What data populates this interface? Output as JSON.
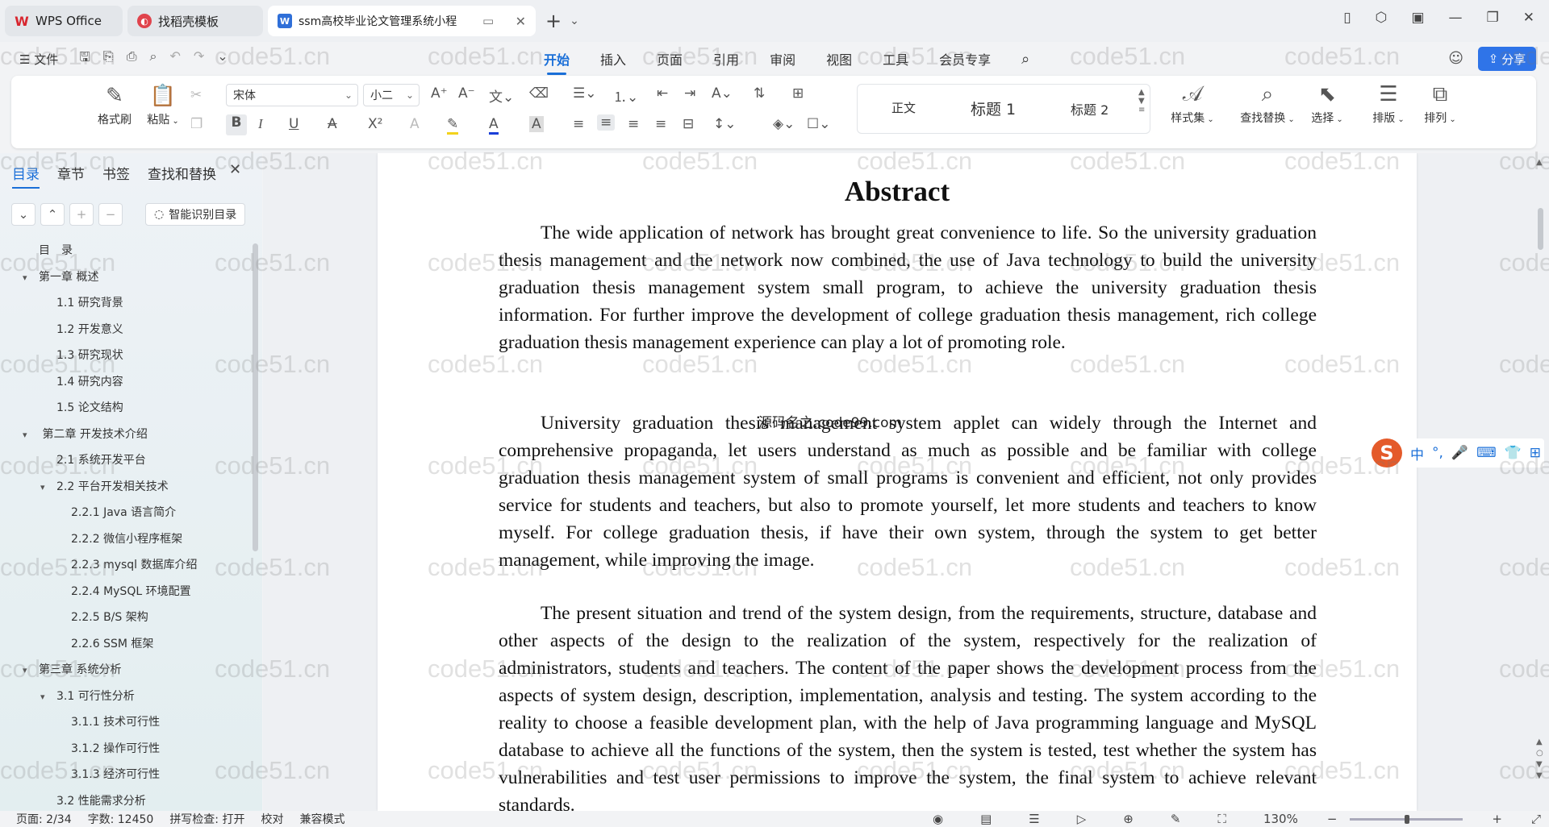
{
  "tabs": [
    {
      "label": "WPS Office",
      "icon": "wps-logo-icon"
    },
    {
      "label": "找稻壳模板",
      "icon": "docer-icon"
    },
    {
      "label": "ssm高校毕业论文管理系统小程",
      "icon": "word-doc-icon"
    }
  ],
  "menubar": {
    "file_label": "文件",
    "menus": [
      "开始",
      "插入",
      "页面",
      "引用",
      "审阅",
      "视图",
      "工具",
      "会员专享"
    ],
    "active_menu": "开始",
    "share_label": "分享"
  },
  "ribbon": {
    "format_painter": "格式刷",
    "paste": "粘贴",
    "font_name": "宋体",
    "font_size": "小二",
    "styles": [
      "正文",
      "标题 1",
      "标题 2"
    ],
    "style_set": "样式集",
    "find_replace": "查找替换",
    "select": "选择",
    "layout": "排版",
    "arrange": "排列",
    "bold_glyph": "B",
    "italic_glyph": "I",
    "underline_glyph": "U",
    "superscript_glyph": "X²"
  },
  "sidebar": {
    "tabs": [
      "目录",
      "章节",
      "书签",
      "查找和替换"
    ],
    "active_tab": "目录",
    "ai_button": "智能识别目录",
    "toc": [
      {
        "label": "目　录",
        "level": 0,
        "toggle": ""
      },
      {
        "label": "第一章  概述",
        "level": 0,
        "toggle": "▾"
      },
      {
        "label": "1.1  研究背景",
        "level": 1,
        "toggle": ""
      },
      {
        "label": "1.2  开发意义",
        "level": 1,
        "toggle": ""
      },
      {
        "label": "1.3  研究现状",
        "level": 1,
        "toggle": ""
      },
      {
        "label": "1.4  研究内容",
        "level": 1,
        "toggle": ""
      },
      {
        "label": "1.5  论文结构",
        "level": 1,
        "toggle": ""
      },
      {
        "label": " 第二章  开发技术介绍",
        "level": 0,
        "toggle": "▾"
      },
      {
        "label": "2.1  系统开发平台",
        "level": 1,
        "toggle": ""
      },
      {
        "label": "2.2  平台开发相关技术",
        "level": 1,
        "toggle": "▾"
      },
      {
        "label": "2.2.1    Java 语言简介",
        "level": 2,
        "toggle": ""
      },
      {
        "label": "2.2.2    微信小程序框架",
        "level": 2,
        "toggle": ""
      },
      {
        "label": "2.2.3    mysql 数据库介绍",
        "level": 2,
        "toggle": ""
      },
      {
        "label": "2.2.4    MySQL 环境配置",
        "level": 2,
        "toggle": ""
      },
      {
        "label": "2.2.5    B/S 架构",
        "level": 2,
        "toggle": ""
      },
      {
        "label": "2.2.6    SSM 框架",
        "level": 2,
        "toggle": ""
      },
      {
        "label": "第三章  系统分析",
        "level": 0,
        "toggle": "▾"
      },
      {
        "label": "3.1  可行性分析",
        "level": 1,
        "toggle": "▾"
      },
      {
        "label": "3.1.1 技术可行性",
        "level": 2,
        "toggle": ""
      },
      {
        "label": "3.1.2 操作可行性",
        "level": 2,
        "toggle": ""
      },
      {
        "label": "3.1.3  经济可行性",
        "level": 2,
        "toggle": ""
      },
      {
        "label": "3.2 性能需求分析",
        "level": 1,
        "toggle": ""
      }
    ]
  },
  "document": {
    "heading": "Abstract",
    "paragraphs": [
      "The wide application of network has brought great convenience to life. So the university graduation thesis management and the network now combined, the use of Java technology to build the university graduation thesis management system small program, to achieve the university graduation thesis information. For further improve the development of college graduation thesis management, rich college graduation thesis management experience can play a lot of promoting role.",
      "University graduation thesis management system applet can widely through the Internet and comprehensive propaganda, let users understand as much as possible and be familiar with college graduation thesis management system of small programs is convenient and efficient, not only provides service for students and teachers, but also to promote yourself, let more students and teachers to know myself. For college graduation thesis, if have their own system, through the system to get better management, while improving the image.",
      "The present situation and trend of the system design, from the requirements, structure, database and other aspects of the design to the realization of the system, respectively for the realization of administrators, students and teachers. The content of the paper shows the development process from the aspects of system design, description, implementation, analysis and testing. The system according to the reality to choose a feasible development plan, with the help of Java programming language and MySQL database to achieve all the functions of the system, then the system is tested, test whether the system has vulnerabilities and test user permissions to improve the system, the final system to achieve relevant standards."
    ],
    "overlay_text": "源码名之:code99.com"
  },
  "ime": {
    "mode": "中",
    "punct": "°,"
  },
  "status": {
    "page": "页面: 2/34",
    "words": "字数: 12450",
    "spell": "拼写检查: 打开",
    "proof": "校对",
    "compat": "兼容模式",
    "zoom": "130%"
  },
  "watermark": "code51.cn"
}
